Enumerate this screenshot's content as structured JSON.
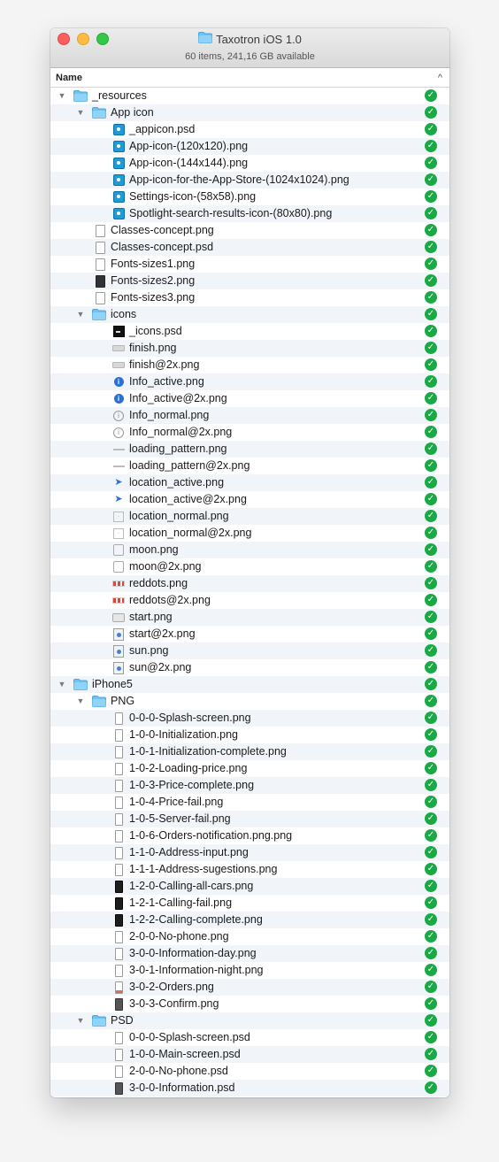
{
  "window": {
    "title": "Taxotron iOS 1.0",
    "status": "60 items, 241,16 GB available"
  },
  "header": {
    "name_label": "Name"
  },
  "colors": {
    "check": "#19aa45",
    "folder": "#6fc3f3",
    "alt_row": "#f1f5f9"
  },
  "rows": [
    {
      "name": "_resources",
      "level": 0,
      "type": "folder",
      "expanded": true
    },
    {
      "name": "App icon",
      "level": 1,
      "type": "folder",
      "expanded": true
    },
    {
      "name": "_appicon.psd",
      "level": 2,
      "icon": "app-icon"
    },
    {
      "name": "App-icon-(120x120).png",
      "level": 2,
      "icon": "app-icon"
    },
    {
      "name": "App-icon-(144x144).png",
      "level": 2,
      "icon": "app-icon"
    },
    {
      "name": "App-icon-for-the-App-Store-(1024x1024).png",
      "level": 2,
      "icon": "app-icon"
    },
    {
      "name": "Settings-icon-(58x58).png",
      "level": 2,
      "icon": "app-icon"
    },
    {
      "name": "Spotlight-search-results-icon-(80x80).png",
      "level": 2,
      "icon": "app-icon"
    },
    {
      "name": "Classes-concept.png",
      "level": 1,
      "icon": "doc-icon"
    },
    {
      "name": "Classes-concept.psd",
      "level": 1,
      "icon": "doc-icon"
    },
    {
      "name": "Fonts-sizes1.png",
      "level": 1,
      "icon": "doc-icon"
    },
    {
      "name": "Fonts-sizes2.png",
      "level": 1,
      "icon": "doc-dark-icon"
    },
    {
      "name": "Fonts-sizes3.png",
      "level": 1,
      "icon": "doc-icon"
    },
    {
      "name": "icons",
      "level": 1,
      "type": "folder",
      "expanded": true
    },
    {
      "name": "_icons.psd",
      "level": 2,
      "icon": "psd-dark-icon"
    },
    {
      "name": "finish.png",
      "level": 2,
      "icon": "bar-icon"
    },
    {
      "name": "finish@2x.png",
      "level": 2,
      "icon": "bar-icon"
    },
    {
      "name": "Info_active.png",
      "level": 2,
      "icon": "info-active-icon"
    },
    {
      "name": "Info_active@2x.png",
      "level": 2,
      "icon": "info-active-icon"
    },
    {
      "name": "Info_normal.png",
      "level": 2,
      "icon": "info-normal-icon"
    },
    {
      "name": "Info_normal@2x.png",
      "level": 2,
      "icon": "info-normal-icon"
    },
    {
      "name": "loading_pattern.png",
      "level": 2,
      "icon": "line-icon"
    },
    {
      "name": "loading_pattern@2x.png",
      "level": 2,
      "icon": "line-icon"
    },
    {
      "name": "location_active.png",
      "level": 2,
      "icon": "location-active-icon"
    },
    {
      "name": "location_active@2x.png",
      "level": 2,
      "icon": "location-active-icon"
    },
    {
      "name": "location_normal.png",
      "level": 2,
      "icon": "location-normal-icon"
    },
    {
      "name": "location_normal@2x.png",
      "level": 2,
      "icon": "location-normal-icon"
    },
    {
      "name": "moon.png",
      "level": 2,
      "icon": "moon-icon"
    },
    {
      "name": "moon@2x.png",
      "level": 2,
      "icon": "moon-icon"
    },
    {
      "name": "reddots.png",
      "level": 2,
      "icon": "reddots-icon"
    },
    {
      "name": "reddots@2x.png",
      "level": 2,
      "icon": "reddots-icon"
    },
    {
      "name": "start.png",
      "level": 2,
      "icon": "start-icon"
    },
    {
      "name": "start@2x.png",
      "level": 2,
      "icon": "sun-icon"
    },
    {
      "name": "sun.png",
      "level": 2,
      "icon": "sun-icon"
    },
    {
      "name": "sun@2x.png",
      "level": 2,
      "icon": "sun-icon"
    },
    {
      "name": "iPhone5",
      "level": 0,
      "type": "folder",
      "expanded": true
    },
    {
      "name": "PNG",
      "level": 1,
      "type": "folder",
      "expanded": true
    },
    {
      "name": "0-0-0-Splash-screen.png",
      "level": 2,
      "icon": "phone-icon"
    },
    {
      "name": "1-0-0-Initialization.png",
      "level": 2,
      "icon": "phone-icon"
    },
    {
      "name": "1-0-1-Initialization-complete.png",
      "level": 2,
      "icon": "phone-icon"
    },
    {
      "name": "1-0-2-Loading-price.png",
      "level": 2,
      "icon": "phone-icon"
    },
    {
      "name": "1-0-3-Price-complete.png",
      "level": 2,
      "icon": "phone-icon"
    },
    {
      "name": "1-0-4-Price-fail.png",
      "level": 2,
      "icon": "phone-icon"
    },
    {
      "name": "1-0-5-Server-fail.png",
      "level": 2,
      "icon": "phone-icon"
    },
    {
      "name": "1-0-6-Orders-notification.png.png",
      "level": 2,
      "icon": "phone-icon"
    },
    {
      "name": "1-1-0-Address-input.png",
      "level": 2,
      "icon": "phone-icon"
    },
    {
      "name": "1-1-1-Address-sugestions.png",
      "level": 2,
      "icon": "phone-icon"
    },
    {
      "name": "1-2-0-Calling-all-cars.png",
      "level": 2,
      "icon": "phone-dark-icon"
    },
    {
      "name": "1-2-1-Calling-fail.png",
      "level": 2,
      "icon": "phone-dark-icon"
    },
    {
      "name": "1-2-2-Calling-complete.png",
      "level": 2,
      "icon": "phone-dark-icon"
    },
    {
      "name": "2-0-0-No-phone.png",
      "level": 2,
      "icon": "phone-icon"
    },
    {
      "name": "3-0-0-Information-day.png",
      "level": 2,
      "icon": "phone-icon"
    },
    {
      "name": "3-0-1-Information-night.png",
      "level": 2,
      "icon": "phone-icon"
    },
    {
      "name": "3-0-2-Orders.png",
      "level": 2,
      "icon": "phone-red-icon"
    },
    {
      "name": "3-0-3-Confirm.png",
      "level": 2,
      "icon": "phone-gray-icon"
    },
    {
      "name": "PSD",
      "level": 1,
      "type": "folder",
      "expanded": true
    },
    {
      "name": "0-0-0-Splash-screen.psd",
      "level": 2,
      "icon": "phone-icon"
    },
    {
      "name": "1-0-0-Main-screen.psd",
      "level": 2,
      "icon": "phone-icon"
    },
    {
      "name": "2-0-0-No-phone.psd",
      "level": 2,
      "icon": "phone-icon"
    },
    {
      "name": "3-0-0-Information.psd",
      "level": 2,
      "icon": "phone-gray-icon"
    }
  ]
}
